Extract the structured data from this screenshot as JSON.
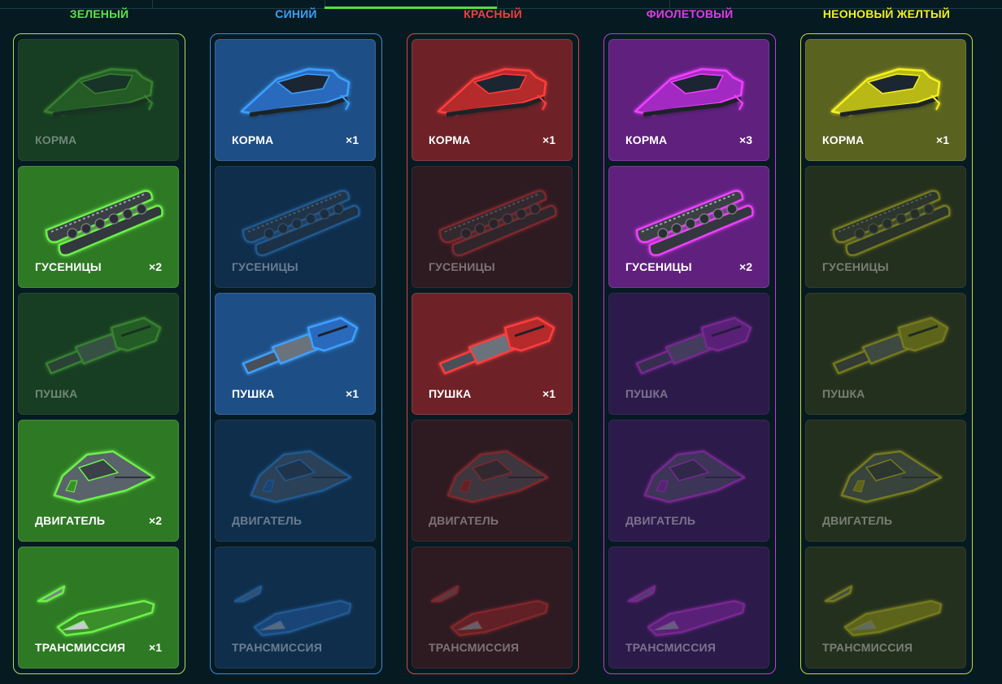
{
  "columns": [
    {
      "id": "green",
      "title": "ЗЕЛЕНЫЙ",
      "colors": {
        "title": "#5ee04a",
        "frame": "#a8e35a",
        "owned_bg": "#2e7a24",
        "locked_bg": "#173d22",
        "glow": "#6cf04a",
        "body": "#3a8f2c"
      },
      "items": [
        {
          "part": "hull",
          "icon": "hull-icon",
          "label": "КОРМА",
          "owned": false,
          "count": ""
        },
        {
          "part": "tracks",
          "icon": "tracks-icon",
          "label": "ГУСЕНИЦЫ",
          "owned": true,
          "count": "×2"
        },
        {
          "part": "cannon",
          "icon": "cannon-icon",
          "label": "ПУШКА",
          "owned": false,
          "count": ""
        },
        {
          "part": "engine",
          "icon": "engine-icon",
          "label": "ДВИГАТЕЛЬ",
          "owned": true,
          "count": "×2"
        },
        {
          "part": "transmission",
          "icon": "transmission-icon",
          "label": "ТРАНСМИССИЯ",
          "owned": true,
          "count": "×1"
        }
      ]
    },
    {
      "id": "blue",
      "title": "СИНИЙ",
      "colors": {
        "title": "#3d9ff5",
        "frame": "#3a8fd6",
        "owned_bg": "#1d4f86",
        "locked_bg": "#0f2e4c",
        "glow": "#3ea0ff",
        "body": "#2a6bbd"
      },
      "items": [
        {
          "part": "hull",
          "icon": "hull-icon",
          "label": "КОРМА",
          "owned": true,
          "count": "×1"
        },
        {
          "part": "tracks",
          "icon": "tracks-icon",
          "label": "ГУСЕНИЦЫ",
          "owned": false,
          "count": ""
        },
        {
          "part": "cannon",
          "icon": "cannon-icon",
          "label": "ПУШКА",
          "owned": true,
          "count": "×1"
        },
        {
          "part": "engine",
          "icon": "engine-icon",
          "label": "ДВИГАТЕЛЬ",
          "owned": false,
          "count": ""
        },
        {
          "part": "transmission",
          "icon": "transmission-icon",
          "label": "ТРАНСМИССИЯ",
          "owned": false,
          "count": ""
        }
      ]
    },
    {
      "id": "red",
      "title": "КРАСНЫЙ",
      "colors": {
        "title": "#f0413d",
        "frame": "#e0444a",
        "owned_bg": "#6e2228",
        "locked_bg": "#2e1b22",
        "glow": "#ff3d3d",
        "body": "#b52a2a"
      },
      "items": [
        {
          "part": "hull",
          "icon": "hull-icon",
          "label": "КОРМА",
          "owned": true,
          "count": "×1"
        },
        {
          "part": "tracks",
          "icon": "tracks-icon",
          "label": "ГУСЕНИЦЫ",
          "owned": false,
          "count": ""
        },
        {
          "part": "cannon",
          "icon": "cannon-icon",
          "label": "ПУШКА",
          "owned": true,
          "count": "×1"
        },
        {
          "part": "engine",
          "icon": "engine-icon",
          "label": "ДВИГАТЕЛЬ",
          "owned": false,
          "count": ""
        },
        {
          "part": "transmission",
          "icon": "transmission-icon",
          "label": "ТРАНСМИССИЯ",
          "owned": false,
          "count": ""
        }
      ]
    },
    {
      "id": "purple",
      "title": "ФИОЛЕТОВЫЙ",
      "colors": {
        "title": "#e23ae8",
        "frame": "#c83ad8",
        "owned_bg": "#60207e",
        "locked_bg": "#2c1a4a",
        "glow": "#ee40ff",
        "body": "#a22cc2"
      },
      "items": [
        {
          "part": "hull",
          "icon": "hull-icon",
          "label": "КОРМА",
          "owned": true,
          "count": "×3"
        },
        {
          "part": "tracks",
          "icon": "tracks-icon",
          "label": "ГУСЕНИЦЫ",
          "owned": true,
          "count": "×2"
        },
        {
          "part": "cannon",
          "icon": "cannon-icon",
          "label": "ПУШКА",
          "owned": false,
          "count": ""
        },
        {
          "part": "engine",
          "icon": "engine-icon",
          "label": "ДВИГАТЕЛЬ",
          "owned": false,
          "count": ""
        },
        {
          "part": "transmission",
          "icon": "transmission-icon",
          "label": "ТРАНСМИССИЯ",
          "owned": false,
          "count": ""
        }
      ]
    },
    {
      "id": "neon-yellow",
      "title": "НЕОНОВЫЙ ЖЕЛТЫЙ",
      "colors": {
        "title": "#f0f020",
        "frame": "#c8d83a",
        "owned_bg": "#5a6220",
        "locked_bg": "#24301e",
        "glow": "#f5f020",
        "body": "#b8b818"
      },
      "items": [
        {
          "part": "hull",
          "icon": "hull-icon",
          "label": "КОРМА",
          "owned": true,
          "count": "×1"
        },
        {
          "part": "tracks",
          "icon": "tracks-icon",
          "label": "ГУСЕНИЦЫ",
          "owned": false,
          "count": ""
        },
        {
          "part": "cannon",
          "icon": "cannon-icon",
          "label": "ПУШКА",
          "owned": false,
          "count": ""
        },
        {
          "part": "engine",
          "icon": "engine-icon",
          "label": "ДВИГАТЕЛЬ",
          "owned": false,
          "count": ""
        },
        {
          "part": "transmission",
          "icon": "transmission-icon",
          "label": "ТРАНСМИССИЯ",
          "owned": false,
          "count": ""
        }
      ]
    }
  ]
}
